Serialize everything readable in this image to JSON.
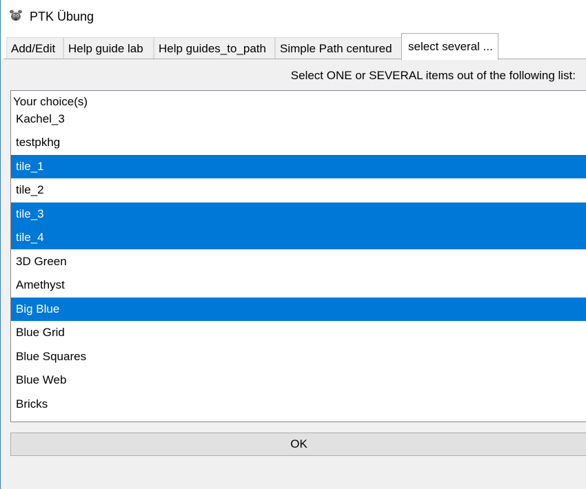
{
  "window": {
    "title": "PTK Übung",
    "icon": "gimp-icon"
  },
  "tabs": [
    {
      "label": "Add/Edit",
      "active": false
    },
    {
      "label": "Help guide lab",
      "active": false
    },
    {
      "label": "Help guides_to_path",
      "active": false
    },
    {
      "label": "Simple Path centured",
      "active": false
    },
    {
      "label": "select several ...",
      "active": true
    }
  ],
  "main": {
    "prompt": "Select ONE or SEVERAL items out of the following list:",
    "list_header": "Your choice(s)",
    "items": [
      {
        "label": "Kachel_3",
        "selected": false
      },
      {
        "label": "testpkhg",
        "selected": false
      },
      {
        "label": "tile_1",
        "selected": true
      },
      {
        "label": "tile_2",
        "selected": false
      },
      {
        "label": "tile_3",
        "selected": true
      },
      {
        "label": "tile_4",
        "selected": true
      },
      {
        "label": "3D Green",
        "selected": false
      },
      {
        "label": "Amethyst",
        "selected": false
      },
      {
        "label": "Big Blue",
        "selected": true
      },
      {
        "label": "Blue Grid",
        "selected": false
      },
      {
        "label": "Blue Squares",
        "selected": false
      },
      {
        "label": "Blue Web",
        "selected": false
      },
      {
        "label": "Bricks",
        "selected": false
      }
    ],
    "ok_label": "OK"
  },
  "colors": {
    "selection": "#0078d7",
    "window_bg": "#f0f0f0"
  }
}
